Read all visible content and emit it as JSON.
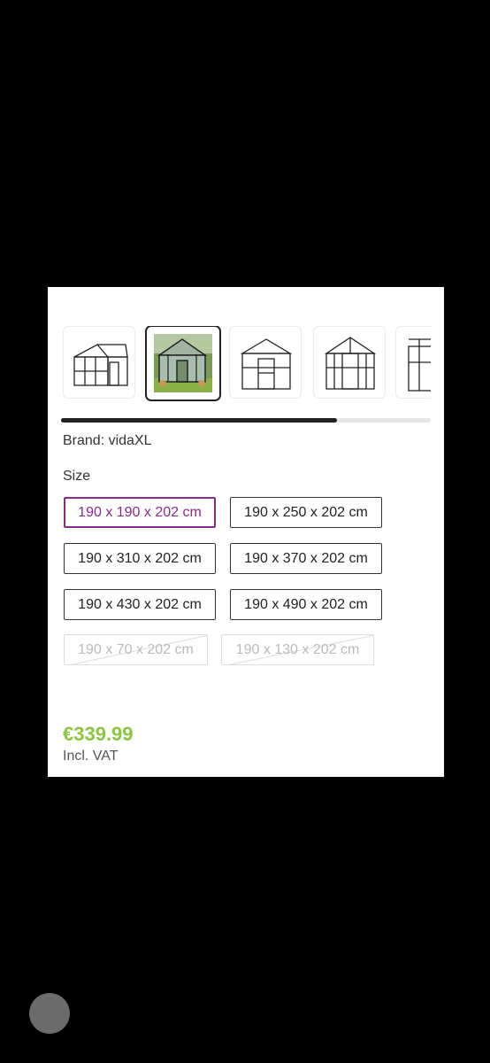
{
  "gallery": {
    "thumbnails": [
      {
        "name": "greenhouse-drawing-side"
      },
      {
        "name": "greenhouse-photo"
      },
      {
        "name": "greenhouse-drawing-front"
      },
      {
        "name": "greenhouse-drawing-front-door"
      },
      {
        "name": "greenhouse-drawing-partial"
      }
    ],
    "selected_index": 1,
    "scroll_progress": 0.746
  },
  "product": {
    "brand_text": "Brand: vidaXL",
    "size_label": "Size",
    "sizes": [
      {
        "label": "190 x 190 x 202 cm",
        "state": "selected"
      },
      {
        "label": "190 x 250 x 202 cm",
        "state": "available"
      },
      {
        "label": "190 x 310 x 202 cm",
        "state": "available"
      },
      {
        "label": "190 x 370 x 202 cm",
        "state": "available"
      },
      {
        "label": "190 x 430 x 202 cm",
        "state": "available"
      },
      {
        "label": "190 x 490 x 202 cm",
        "state": "available"
      },
      {
        "label": "190 x 70 x 202 cm",
        "state": "unavailable"
      },
      {
        "label": "190 x 130 x 202 cm",
        "state": "unavailable"
      }
    ],
    "price": "€339.99",
    "vat_note": "Incl. VAT"
  },
  "colors": {
    "selected_accent": "#8a2a8a",
    "price_green": "#8cc63f"
  }
}
